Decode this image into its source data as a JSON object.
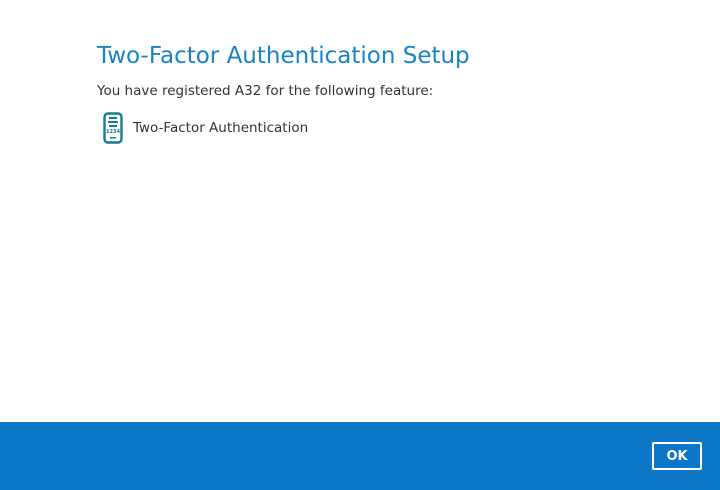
{
  "page": {
    "title": "Two-Factor Authentication Setup",
    "intro": "You have registered A32 for the following feature:"
  },
  "feature": {
    "label": "Two-Factor Authentication",
    "icon": "phone-passcode-icon",
    "icon_text": "1234"
  },
  "footer": {
    "ok_label": "OK"
  },
  "colors": {
    "title": "#1b82c5",
    "footer_background": "#0c77c6",
    "icon_teal": "#137f8e"
  }
}
